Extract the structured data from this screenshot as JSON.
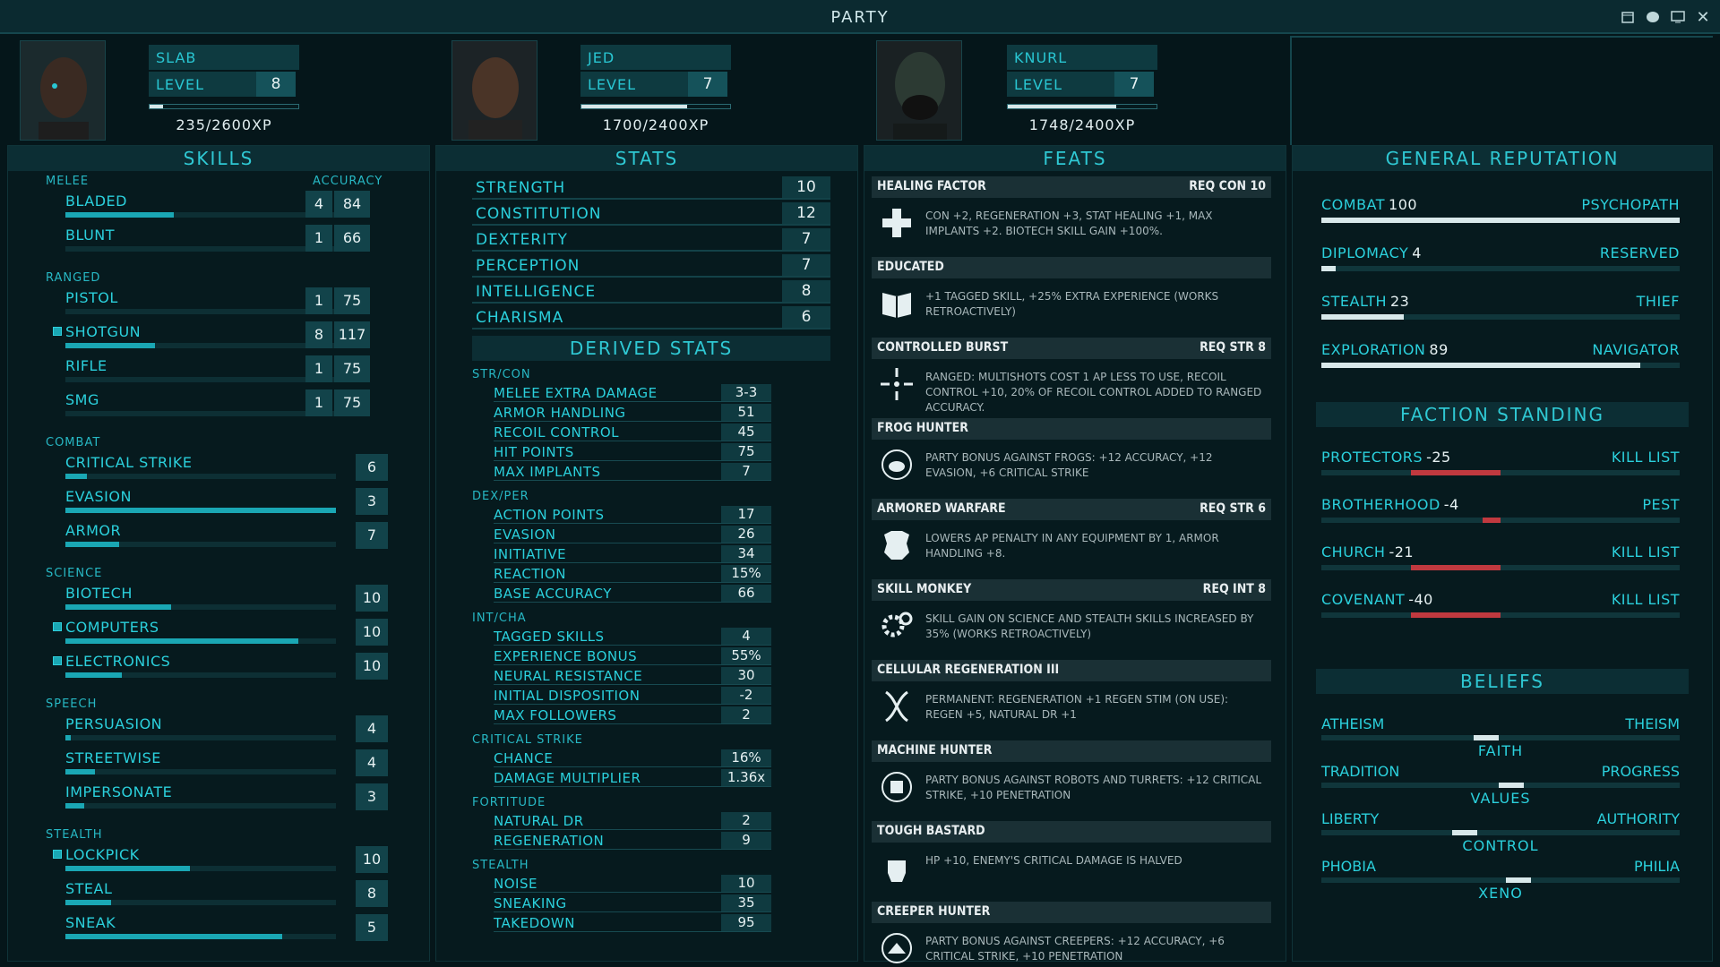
{
  "window": {
    "title": "PARTY"
  },
  "party": [
    {
      "name": "SLAB",
      "level_label": "LEVEL",
      "level": "8",
      "xp": "235/2600XP",
      "xp_progress": 0.09
    },
    {
      "name": "JED",
      "level_label": "LEVEL",
      "level": "7",
      "xp": "1700/2400XP",
      "xp_progress": 0.71
    },
    {
      "name": "KNURL",
      "level_label": "LEVEL",
      "level": "7",
      "xp": "1748/2400XP",
      "xp_progress": 0.73
    }
  ],
  "skills": {
    "title": "SKILLS",
    "accuracy_label": "ACCURACY",
    "categories": [
      {
        "name": "MELEE",
        "items": [
          {
            "name": "BLADED",
            "value": "4",
            "accuracy": "84",
            "progress": 0.4,
            "tagged": false
          },
          {
            "name": "BLUNT",
            "value": "1",
            "accuracy": "66",
            "progress": 0,
            "tagged": false
          }
        ]
      },
      {
        "name": "RANGED",
        "items": [
          {
            "name": "PISTOL",
            "value": "1",
            "accuracy": "75",
            "progress": 0,
            "tagged": false
          },
          {
            "name": "SHOTGUN",
            "value": "8",
            "accuracy": "117",
            "progress": 0.33,
            "tagged": true
          },
          {
            "name": "RIFLE",
            "value": "1",
            "accuracy": "75",
            "progress": 0,
            "tagged": false
          },
          {
            "name": "SMG",
            "value": "1",
            "accuracy": "75",
            "progress": 0,
            "tagged": false
          }
        ]
      },
      {
        "name": "COMBAT",
        "items": [
          {
            "name": "CRITICAL STRIKE",
            "value": "6",
            "progress": 0.08,
            "tagged": false
          },
          {
            "name": "EVASION",
            "value": "3",
            "progress": 1.0,
            "tagged": false
          },
          {
            "name": "ARMOR",
            "value": "7",
            "progress": 0.2,
            "tagged": false
          }
        ]
      },
      {
        "name": "SCIENCE",
        "items": [
          {
            "name": "BIOTECH",
            "value": "10",
            "progress": 0.39,
            "tagged": false
          },
          {
            "name": "COMPUTERS",
            "value": "10",
            "progress": 0.86,
            "tagged": true
          },
          {
            "name": "ELECTRONICS",
            "value": "10",
            "progress": 0.21,
            "tagged": true
          }
        ]
      },
      {
        "name": "SPEECH",
        "items": [
          {
            "name": "PERSUASION",
            "value": "4",
            "progress": 0.02,
            "tagged": false
          },
          {
            "name": "STREETWISE",
            "value": "4",
            "progress": 0.11,
            "tagged": false
          },
          {
            "name": "IMPERSONATE",
            "value": "3",
            "progress": 0.07,
            "tagged": false
          }
        ]
      },
      {
        "name": "STEALTH",
        "items": [
          {
            "name": "LOCKPICK",
            "value": "10",
            "progress": 0.46,
            "tagged": true
          },
          {
            "name": "STEAL",
            "value": "8",
            "progress": 0.17,
            "tagged": false
          },
          {
            "name": "SNEAK",
            "value": "5",
            "progress": 0.8,
            "tagged": false
          }
        ]
      }
    ]
  },
  "stats": {
    "title": "STATS",
    "items": [
      {
        "name": "STRENGTH",
        "value": "10"
      },
      {
        "name": "CONSTITUTION",
        "value": "12"
      },
      {
        "name": "DEXTERITY",
        "value": "7"
      },
      {
        "name": "PERCEPTION",
        "value": "7"
      },
      {
        "name": "INTELLIGENCE",
        "value": "8"
      },
      {
        "name": "CHARISMA",
        "value": "6"
      }
    ],
    "derived_title": "DERIVED STATS",
    "derived": [
      {
        "group": "STR/CON",
        "items": [
          {
            "name": "MELEE EXTRA DAMAGE",
            "value": "3-3"
          },
          {
            "name": "ARMOR HANDLING",
            "value": "51"
          },
          {
            "name": "RECOIL CONTROL",
            "value": "45"
          },
          {
            "name": "HIT POINTS",
            "value": "75"
          },
          {
            "name": "MAX IMPLANTS",
            "value": "7"
          }
        ]
      },
      {
        "group": "DEX/PER",
        "items": [
          {
            "name": "ACTION POINTS",
            "value": "17"
          },
          {
            "name": "EVASION",
            "value": "26"
          },
          {
            "name": "INITIATIVE",
            "value": "34"
          },
          {
            "name": "REACTION",
            "value": "15%"
          },
          {
            "name": "BASE ACCURACY",
            "value": "66"
          }
        ]
      },
      {
        "group": "INT/CHA",
        "items": [
          {
            "name": "TAGGED SKILLS",
            "value": "4"
          },
          {
            "name": "EXPERIENCE BONUS",
            "value": "55%"
          },
          {
            "name": "NEURAL RESISTANCE",
            "value": "30"
          },
          {
            "name": "INITIAL DISPOSITION",
            "value": "-2"
          },
          {
            "name": "MAX FOLLOWERS",
            "value": "2"
          }
        ]
      },
      {
        "group": "CRITICAL STRIKE",
        "items": [
          {
            "name": "CHANCE",
            "value": "16%"
          },
          {
            "name": "DAMAGE MULTIPLIER",
            "value": "1.36x"
          }
        ]
      },
      {
        "group": "FORTITUDE",
        "items": [
          {
            "name": "NATURAL DR",
            "value": "2"
          },
          {
            "name": "REGENERATION",
            "value": "9"
          }
        ]
      },
      {
        "group": "STEALTH",
        "items": [
          {
            "name": "NOISE",
            "value": "10"
          },
          {
            "name": "SNEAKING",
            "value": "35"
          },
          {
            "name": "TAKEDOWN",
            "value": "95"
          }
        ]
      }
    ]
  },
  "feats": {
    "title": "FEATS",
    "items": [
      {
        "name": "HEALING FACTOR",
        "req": "REQ CON 10",
        "icon": "plus-icon",
        "desc": "CON +2, REGENERATION +3, STAT HEALING +1, MAX IMPLANTS +2. BIOTECH SKILL GAIN +100%."
      },
      {
        "name": "EDUCATED",
        "req": "",
        "icon": "book-icon",
        "desc": "+1 TAGGED SKILL, +25% EXTRA EXPERIENCE (WORKS RETROACTIVELY)"
      },
      {
        "name": "CONTROLLED BURST",
        "req": "REQ STR 8",
        "icon": "crosshair-icon",
        "desc": "RANGED: MULTISHOTS COST 1 AP LESS TO USE, RECOIL CONTROL +10, 20% OF RECOIL CONTROL ADDED TO RANGED ACCURACY."
      },
      {
        "name": "FROG HUNTER",
        "req": "",
        "icon": "frog-target-icon",
        "desc": "PARTY BONUS AGAINST FROGS: +12 ACCURACY, +12 EVASION, +6 CRITICAL STRIKE"
      },
      {
        "name": "ARMORED WARFARE",
        "req": "REQ STR 6",
        "icon": "armor-icon",
        "desc": "LOWERS AP PENALTY IN ANY EQUIPMENT BY 1, ARMOR HANDLING +8."
      },
      {
        "name": "SKILL MONKEY",
        "req": "REQ INT 8",
        "icon": "gears-icon",
        "desc": "SKILL GAIN ON SCIENCE AND STEALTH SKILLS INCREASED BY 35% (WORKS RETROACTIVELY)"
      },
      {
        "name": "CELLULAR REGENERATION III",
        "req": "",
        "icon": "dna-icon",
        "desc": "PERMANENT: REGENERATION +1 REGEN STIM (ON USE): REGEN +5, NATURAL DR +1"
      },
      {
        "name": "MACHINE HUNTER",
        "req": "",
        "icon": "robot-target-icon",
        "desc": "PARTY BONUS AGAINST ROBOTS AND TURRETS: +12 CRITICAL STRIKE, +10 PENETRATION"
      },
      {
        "name": "TOUGH BASTARD",
        "req": "",
        "icon": "fist-icon",
        "desc": "HP +10, ENEMY'S CRITICAL DAMAGE IS HALVED"
      },
      {
        "name": "CREEPER HUNTER",
        "req": "",
        "icon": "creeper-target-icon",
        "desc": "PARTY BONUS AGAINST CREEPERS: +12 ACCURACY, +6 CRITICAL STRIKE, +10 PENETRATION"
      }
    ]
  },
  "reputation": {
    "title": "GENERAL REPUTATION",
    "items": [
      {
        "name": "COMBAT",
        "value": "100",
        "title": "PSYCHOPATH",
        "progress": 1.0
      },
      {
        "name": "DIPLOMACY",
        "value": "4",
        "title": "RESERVED",
        "progress": 0.04
      },
      {
        "name": "STEALTH",
        "value": "23",
        "title": "THIEF",
        "progress": 0.23
      },
      {
        "name": "EXPLORATION",
        "value": "89",
        "title": "NAVIGATOR",
        "progress": 0.89
      }
    ],
    "faction_title": "FACTION STANDING",
    "factions": [
      {
        "name": "PROTECTORS",
        "value": "-25",
        "title": "KILL LIST",
        "progress": -0.5
      },
      {
        "name": "BROTHERHOOD",
        "value": "-4",
        "title": "PEST",
        "progress": -0.1
      },
      {
        "name": "CHURCH",
        "value": "-21",
        "title": "KILL LIST",
        "progress": -0.5
      },
      {
        "name": "COVENANT",
        "value": "-40",
        "title": "KILL LIST",
        "progress": -0.5
      }
    ],
    "beliefs_title": "BELIEFS",
    "beliefs": [
      {
        "left": "ATHEISM",
        "right": "THEISM",
        "center": "FAITH",
        "position": 0.46
      },
      {
        "left": "TRADITION",
        "right": "PROGRESS",
        "center": "VALUES",
        "position": 0.53
      },
      {
        "left": "LIBERTY",
        "right": "AUTHORITY",
        "center": "CONTROL",
        "position": 0.4
      },
      {
        "left": "PHOBIA",
        "right": "PHILIA",
        "center": "XENO",
        "position": 0.55
      }
    ]
  },
  "colors": {
    "accent": "#2bd0dc",
    "bar": "#1aa7b4",
    "negative": "#c0393f",
    "positive": "#d8e8ea"
  }
}
